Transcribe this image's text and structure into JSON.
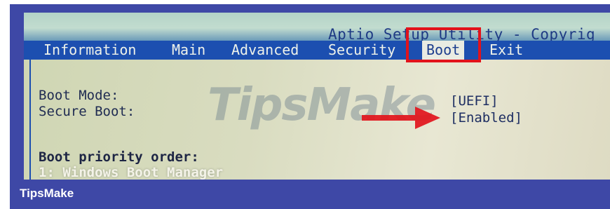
{
  "window": {
    "title": "Aptio Setup Utility - Copyrig"
  },
  "menu": {
    "tabs": [
      {
        "label": "Information"
      },
      {
        "label": "Main"
      },
      {
        "label": "Advanced"
      },
      {
        "label": "Security"
      },
      {
        "label": "Boot"
      },
      {
        "label": "Exit"
      }
    ],
    "active_tab": "Boot"
  },
  "settings": {
    "boot_mode": {
      "label": "Boot Mode:",
      "value": "[UEFI]"
    },
    "secure_boot": {
      "label": "Secure Boot:",
      "value": "[Enabled]"
    }
  },
  "boot_priority": {
    "heading": "Boot priority order:",
    "items": [
      "1: Windows Boot Manager"
    ]
  },
  "watermark": {
    "text": "TipsMake"
  },
  "caption": {
    "text": "TipsMake"
  },
  "colors": {
    "menubar": "#1c4fb0",
    "highlight": "#e2131b",
    "frame": "#3e48a6"
  }
}
